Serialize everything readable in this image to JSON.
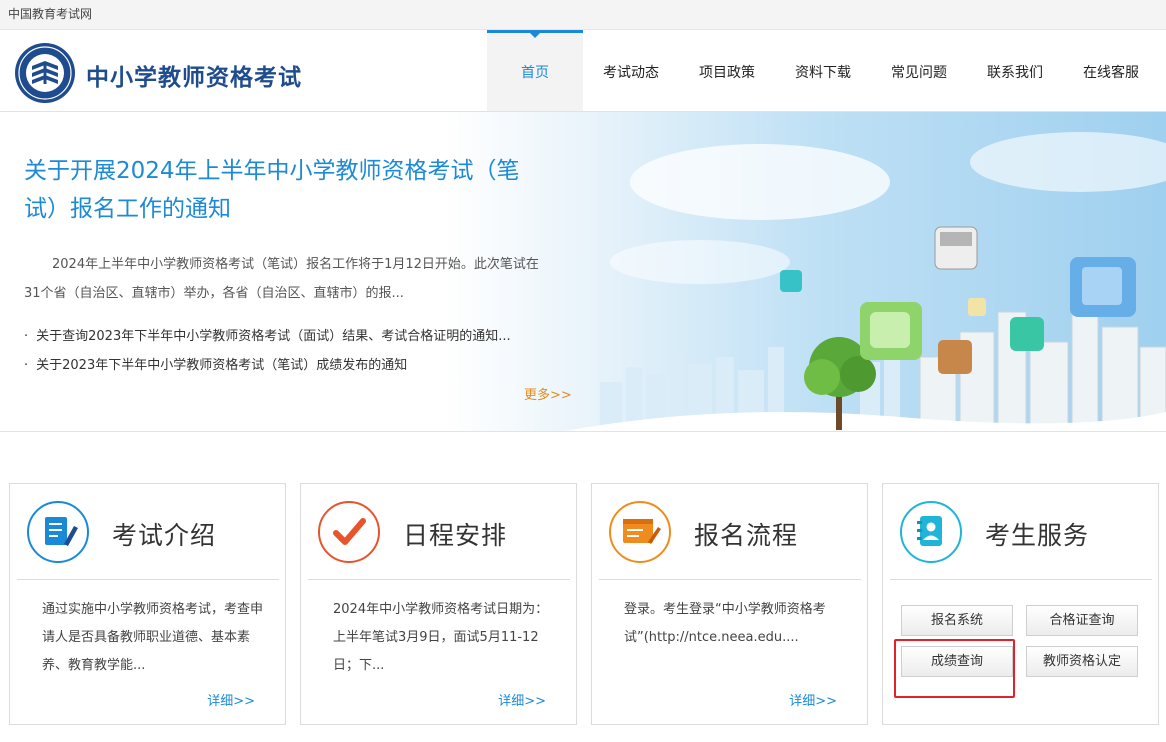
{
  "topbar": {
    "site_name": "中国教育考试网"
  },
  "header": {
    "title": "中小学教师资格考试",
    "nav": [
      {
        "label": "首页",
        "active": true
      },
      {
        "label": "考试动态",
        "active": false
      },
      {
        "label": "项目政策",
        "active": false
      },
      {
        "label": "资料下载",
        "active": false
      },
      {
        "label": "常见问题",
        "active": false
      },
      {
        "label": "联系我们",
        "active": false
      },
      {
        "label": "在线客服",
        "active": false
      }
    ]
  },
  "banner": {
    "headline": "关于开展2024年上半年中小学教师资格考试（笔试）报名工作的通知",
    "summary": "2024年上半年中小学教师资格考试（笔试）报名工作将于1月12日开始。此次笔试在31个省（自治区、直辖市）举办，各省（自治区、直辖市）的报...",
    "news": [
      "关于查询2023年下半年中小学教师资格考试（面试）结果、考试合格证明的通知...",
      "关于2023年下半年中小学教师资格考试（笔试）成绩发布的通知"
    ],
    "more": "更多>>"
  },
  "cards": [
    {
      "title": "考试介绍",
      "icon": "document-pen-icon",
      "text": "通过实施中小学教师资格考试，考查申请人是否具备教师职业道德、基本素养、教育教学能...",
      "more": "详细>>"
    },
    {
      "title": "日程安排",
      "icon": "checkmark-icon",
      "text": "2024年中小学教师资格考试日期为：上半年笔试3月9日，面试5月11-12日；下...",
      "more": "详细>>"
    },
    {
      "title": "报名流程",
      "icon": "browser-pen-icon",
      "text": "登录。考生登录“中小学教师资格考试”(http://ntce.neea.edu....",
      "more": "详细>>"
    }
  ],
  "service": {
    "title": "考生服务",
    "icon": "contact-book-icon",
    "buttons": {
      "register": "报名系统",
      "certificate": "合格证查询",
      "score": "成绩查询",
      "qualification": "教师资格认定"
    }
  },
  "colors": {
    "brand_blue": "#1a8ad8",
    "title_navy": "#1f4c8f",
    "more_orange": "#e58a1a",
    "highlight_red": "#e3212b"
  }
}
